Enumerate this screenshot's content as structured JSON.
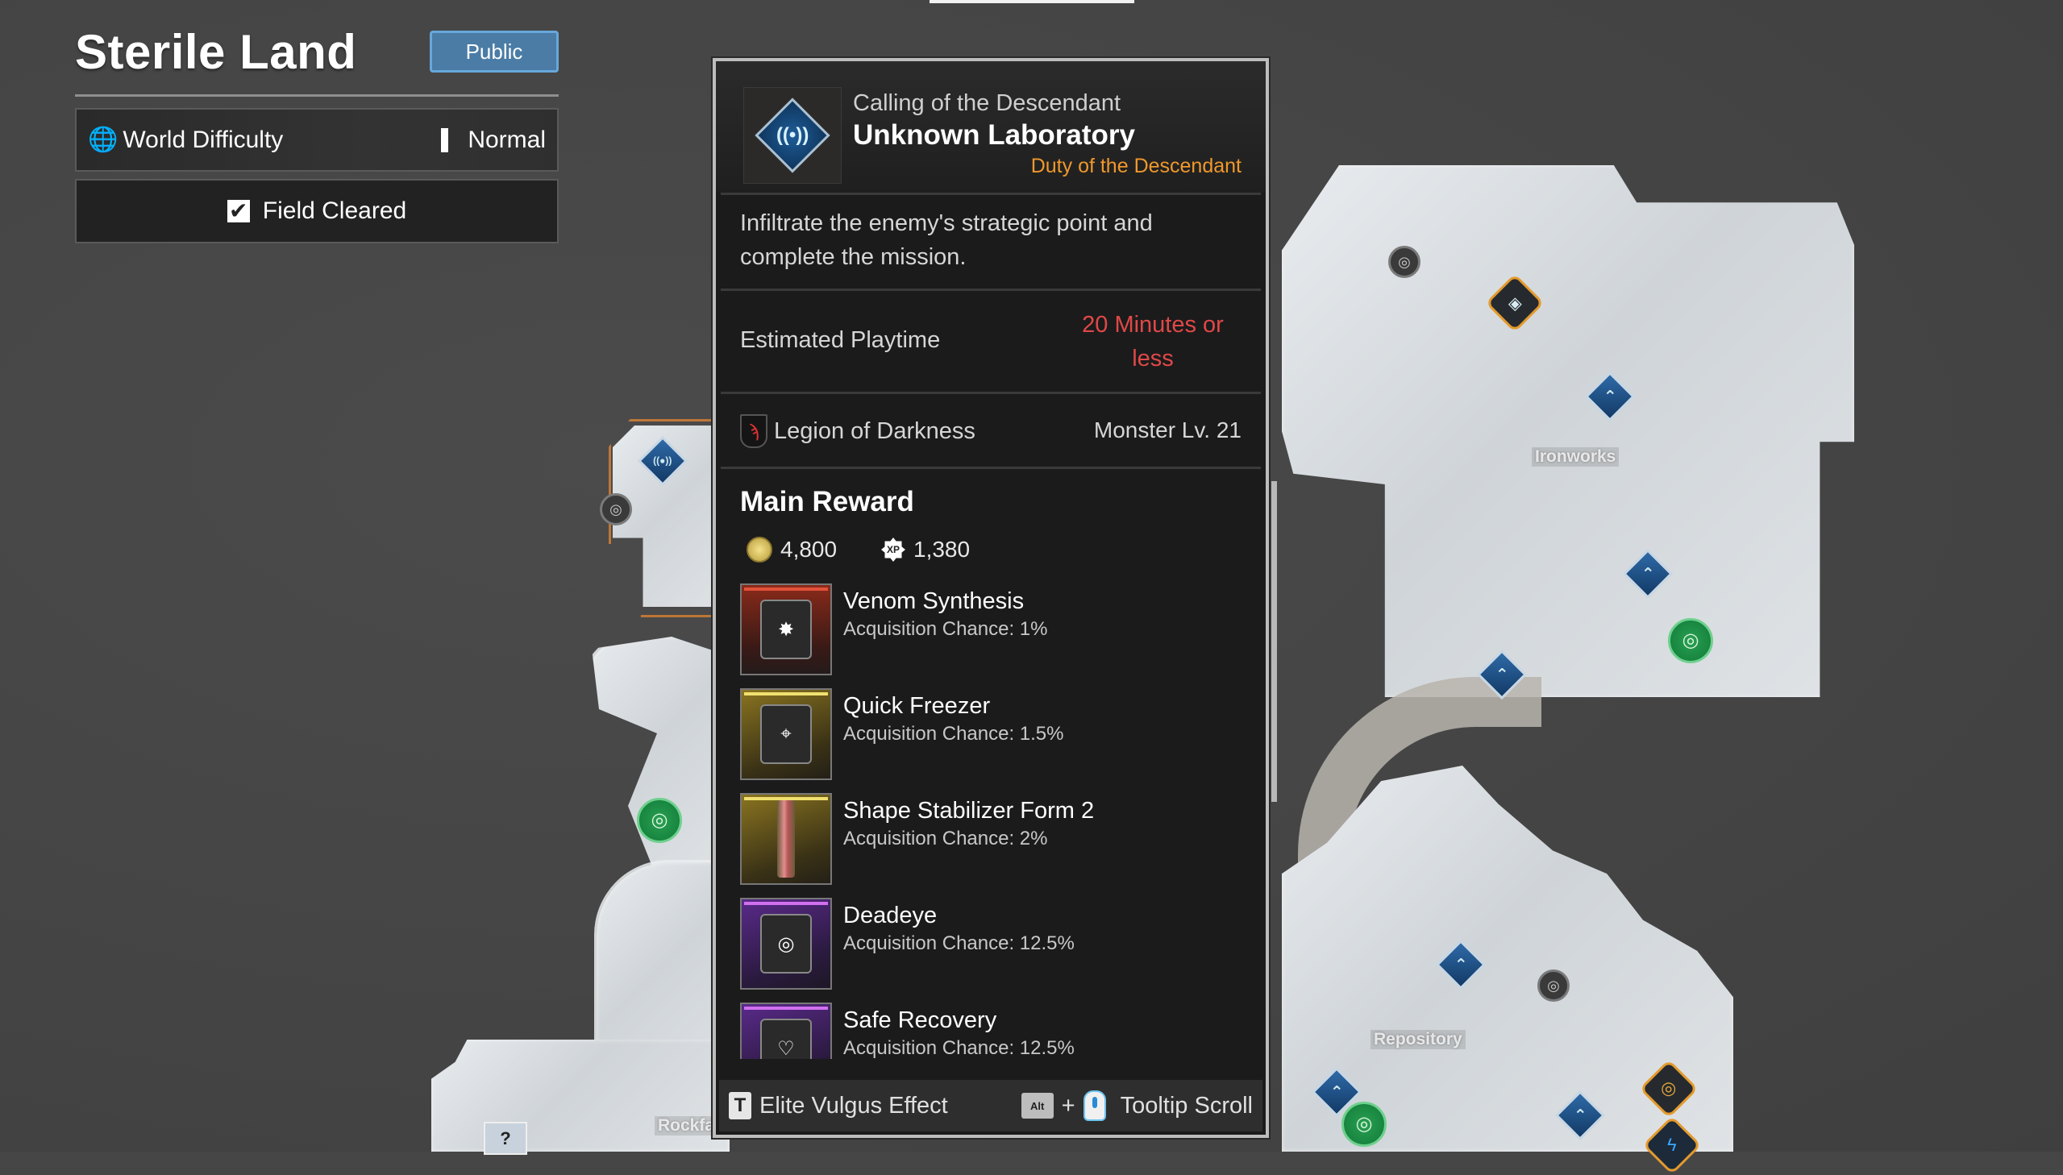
{
  "hud": {
    "region_title": "Sterile Land",
    "visibility_button": "Public",
    "world_difficulty_label": "World Difficulty",
    "world_difficulty_value": "Normal",
    "field_status": "Field Cleared",
    "field_cleared_checked": true
  },
  "map": {
    "labels": [
      "Ironworks",
      "Repository",
      "Rockfa"
    ],
    "marker_icons": {
      "waypoint": "⌃",
      "target": "◎",
      "mission": "◈",
      "lightning": "ϟ",
      "unknown": "?",
      "selected": "((●))"
    }
  },
  "tooltip": {
    "category": "Calling of the Descendant",
    "title": "Unknown Laboratory",
    "tag": "Duty of the Descendant",
    "tag_color": "#f0982c",
    "description": "Infiltrate the enemy's strategic point and complete the mission.",
    "playtime_label": "Estimated Playtime",
    "playtime_value": "20 Minutes or less",
    "playtime_color": "#e04848",
    "faction": "Legion of Darkness",
    "monster_level": "Monster Lv. 21",
    "reward_heading": "Main Reward",
    "gold": "4,800",
    "xp_badge": "XP",
    "xp": "1,380",
    "rewards": [
      {
        "name": "Venom Synthesis",
        "chance": "Acquisition Chance: 1%",
        "rarity": "red",
        "glyph": "✸"
      },
      {
        "name": "Quick Freezer",
        "chance": "Acquisition Chance: 1.5%",
        "rarity": "gold",
        "glyph": "⌖"
      },
      {
        "name": "Shape Stabilizer Form 2",
        "chance": "Acquisition Chance: 2%",
        "rarity": "gold",
        "glyph": ""
      },
      {
        "name": "Deadeye",
        "chance": "Acquisition Chance: 12.5%",
        "rarity": "purple",
        "glyph": "◎"
      },
      {
        "name": "Safe Recovery",
        "chance": "Acquisition Chance: 12.5%",
        "rarity": "purple",
        "glyph": "♡"
      }
    ],
    "footer": {
      "key_t": "T",
      "elite_label": "Elite Vulgus Effect",
      "key_alt": "Alt",
      "plus": "+",
      "scroll_label": "Tooltip Scroll"
    }
  }
}
